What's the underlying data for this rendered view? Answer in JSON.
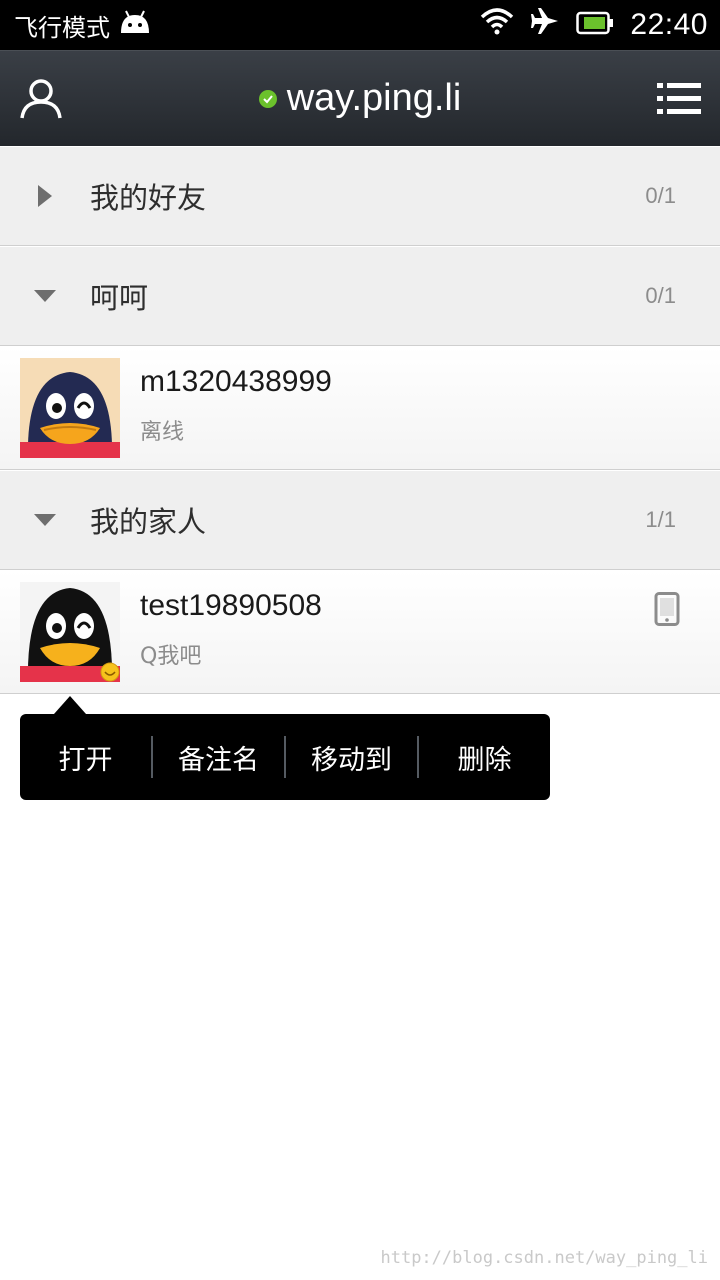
{
  "status_bar": {
    "mode_label": "飞行模式",
    "time": "22:40"
  },
  "title_bar": {
    "account_name": "way.ping.li"
  },
  "groups": [
    {
      "name": "我的好友",
      "count": "0/1",
      "expanded": false
    },
    {
      "name": "呵呵",
      "count": "0/1",
      "expanded": true
    },
    {
      "name": "我的家人",
      "count": "1/1",
      "expanded": true
    }
  ],
  "contacts": [
    {
      "name": "m1320438999",
      "status": "离线"
    },
    {
      "name": "test19890508",
      "status": "Q我吧"
    }
  ],
  "context_menu": {
    "items": [
      "打开",
      "备注名",
      "移动到",
      "删除"
    ]
  },
  "watermark": "http://blog.csdn.net/way_ping_li",
  "colors": {
    "online": "#6bc12c",
    "title_bar": "#2c3035",
    "group_bg": "#efefef"
  }
}
